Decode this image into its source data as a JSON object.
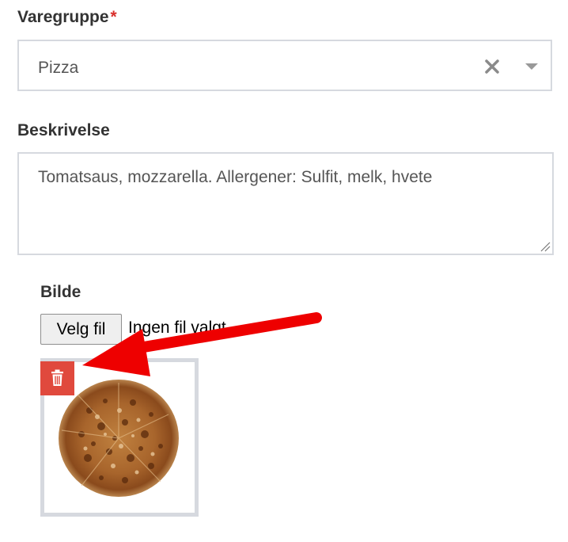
{
  "category_field": {
    "label": "Varegruppe",
    "required_marker": "*",
    "selected_value": "Pizza",
    "clear_icon": "close-icon",
    "dropdown_icon": "caret-down-icon"
  },
  "description_field": {
    "label": "Beskrivelse",
    "value": "Tomatsaus, mozzarella. Allergener: Sulfit, melk, hvete"
  },
  "image_field": {
    "label": "Bilde",
    "choose_file_label": "Velg fil",
    "file_status": "Ingen fil valgt",
    "delete_icon": "trash-icon",
    "image_subject": "pizza"
  },
  "colors": {
    "required": "#d9302c",
    "delete_button": "#e0493d",
    "annotation_arrow": "#ee0000",
    "field_border": "#d6d9df"
  }
}
